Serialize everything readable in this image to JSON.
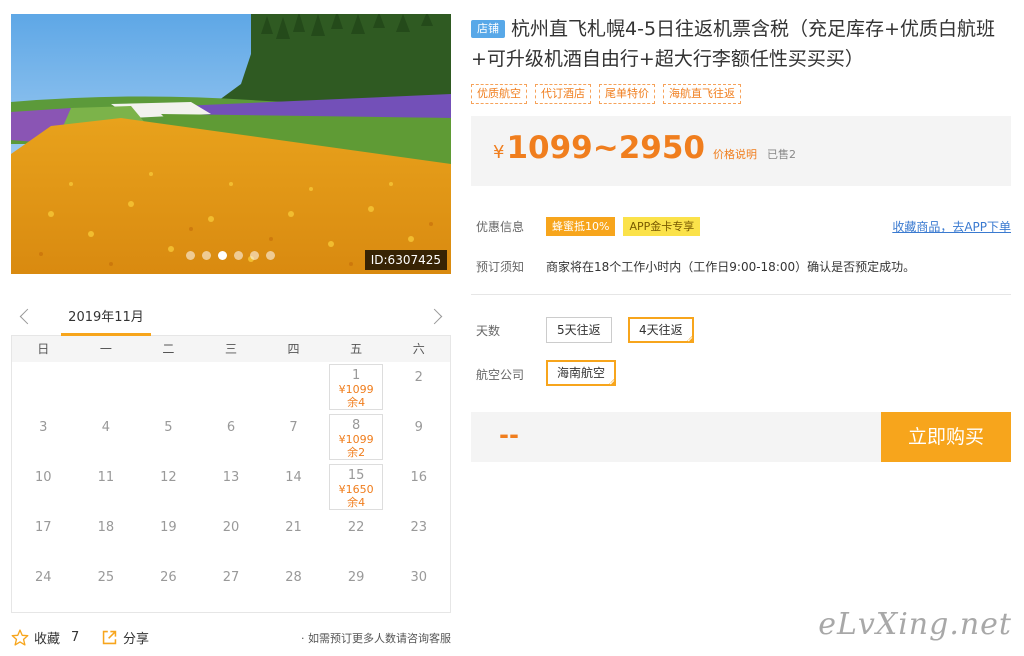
{
  "photo": {
    "id_label": "ID:6307425",
    "slides": 6,
    "active_slide": 3
  },
  "calendar": {
    "month_label": "2019年11月",
    "weekdays": [
      "日",
      "一",
      "二",
      "三",
      "四",
      "五",
      "六"
    ],
    "rows": [
      [
        {
          "d": ""
        },
        {
          "d": ""
        },
        {
          "d": ""
        },
        {
          "d": ""
        },
        {
          "d": ""
        },
        {
          "d": "1",
          "price": "¥1099",
          "stock": "余4"
        },
        {
          "d": "2"
        }
      ],
      [
        {
          "d": "3"
        },
        {
          "d": "4"
        },
        {
          "d": "5"
        },
        {
          "d": "6"
        },
        {
          "d": "7"
        },
        {
          "d": "8",
          "price": "¥1099",
          "stock": "余2"
        },
        {
          "d": "9"
        }
      ],
      [
        {
          "d": "10"
        },
        {
          "d": "11"
        },
        {
          "d": "12"
        },
        {
          "d": "13"
        },
        {
          "d": "14"
        },
        {
          "d": "15",
          "price": "¥1650",
          "stock": "余4"
        },
        {
          "d": "16"
        }
      ],
      [
        {
          "d": "17"
        },
        {
          "d": "18"
        },
        {
          "d": "19"
        },
        {
          "d": "20"
        },
        {
          "d": "21"
        },
        {
          "d": "22"
        },
        {
          "d": "23"
        }
      ],
      [
        {
          "d": "24"
        },
        {
          "d": "25"
        },
        {
          "d": "26"
        },
        {
          "d": "27"
        },
        {
          "d": "28"
        },
        {
          "d": "29"
        },
        {
          "d": "30"
        }
      ]
    ]
  },
  "footer": {
    "favorite_label": "收藏",
    "favorite_count": "7",
    "share_label": "分享",
    "note": "· 如需预订更多人数请咨询客服"
  },
  "product": {
    "shop_tag": "店铺",
    "title": "杭州直飞札幌4-5日往返机票含税（充足库存+优质白航班+可升级机酒自由行+超大行李额任性买买买）",
    "tags": [
      "优质航空",
      "代订酒店",
      "尾单特价",
      "海航直飞往返"
    ],
    "price_currency": "¥",
    "price_range": "1099~2950",
    "price_explain": "价格说明",
    "sold": "已售2",
    "promo_label": "优惠信息",
    "promo_badges": [
      "蜂蜜抵10%",
      "APP金卡专享"
    ],
    "app_link": "收藏商品，去APP下单",
    "booking_label": "预订须知",
    "booking_text": "商家将在18个工作小时内（工作日9:00-18:00）确认是否预定成功。",
    "days_label": "天数",
    "days_options": [
      "5天往返",
      "4天往返"
    ],
    "airline_label": "航空公司",
    "airline_options": [
      "海南航空"
    ],
    "buy_price": "--",
    "buy_button": "立即购买"
  },
  "watermark": "eLvXing.net",
  "colors": {
    "accent": "#f7a51c",
    "price": "#f07e1e",
    "shop_tag": "#58a8e8",
    "link": "#3a7ad0"
  }
}
